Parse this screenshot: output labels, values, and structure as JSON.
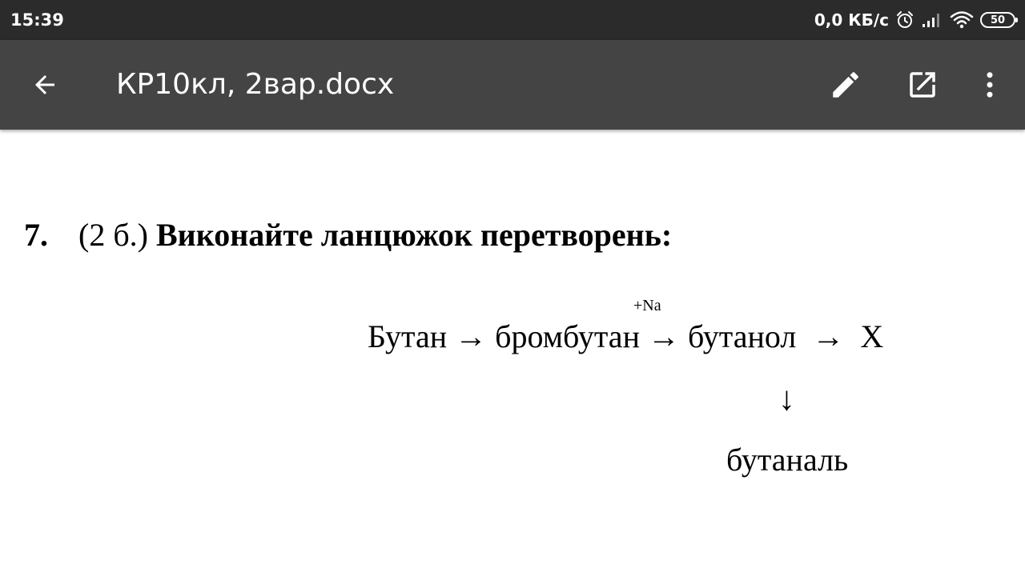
{
  "status_bar": {
    "time": "15:39",
    "network_speed": "0,0 КБ/с",
    "battery_level": "50",
    "icons": [
      "alarm-icon",
      "signal-icon",
      "wifi-icon",
      "battery-icon"
    ]
  },
  "app_bar": {
    "title": "КР10кл, 2вар.docx",
    "background_color": "#444444",
    "icons": {
      "back": "arrow-back-icon",
      "edit": "pencil-icon",
      "open": "open-in-new-icon",
      "more": "more-vert-icon"
    }
  },
  "document": {
    "question_7": {
      "number": "7.",
      "points": "(2 б.)",
      "text": "Виконайте ланцюжок перетворень:"
    },
    "chain": {
      "reagent": "+Na",
      "step_1": "Бутан",
      "arrow_1": "→",
      "step_2": "бромбутан",
      "arrow_2": "→",
      "step_3": "бутанол",
      "arrow_3": "→",
      "step_4": "X",
      "down_arrow": "↓",
      "branch": "бутаналь"
    }
  }
}
